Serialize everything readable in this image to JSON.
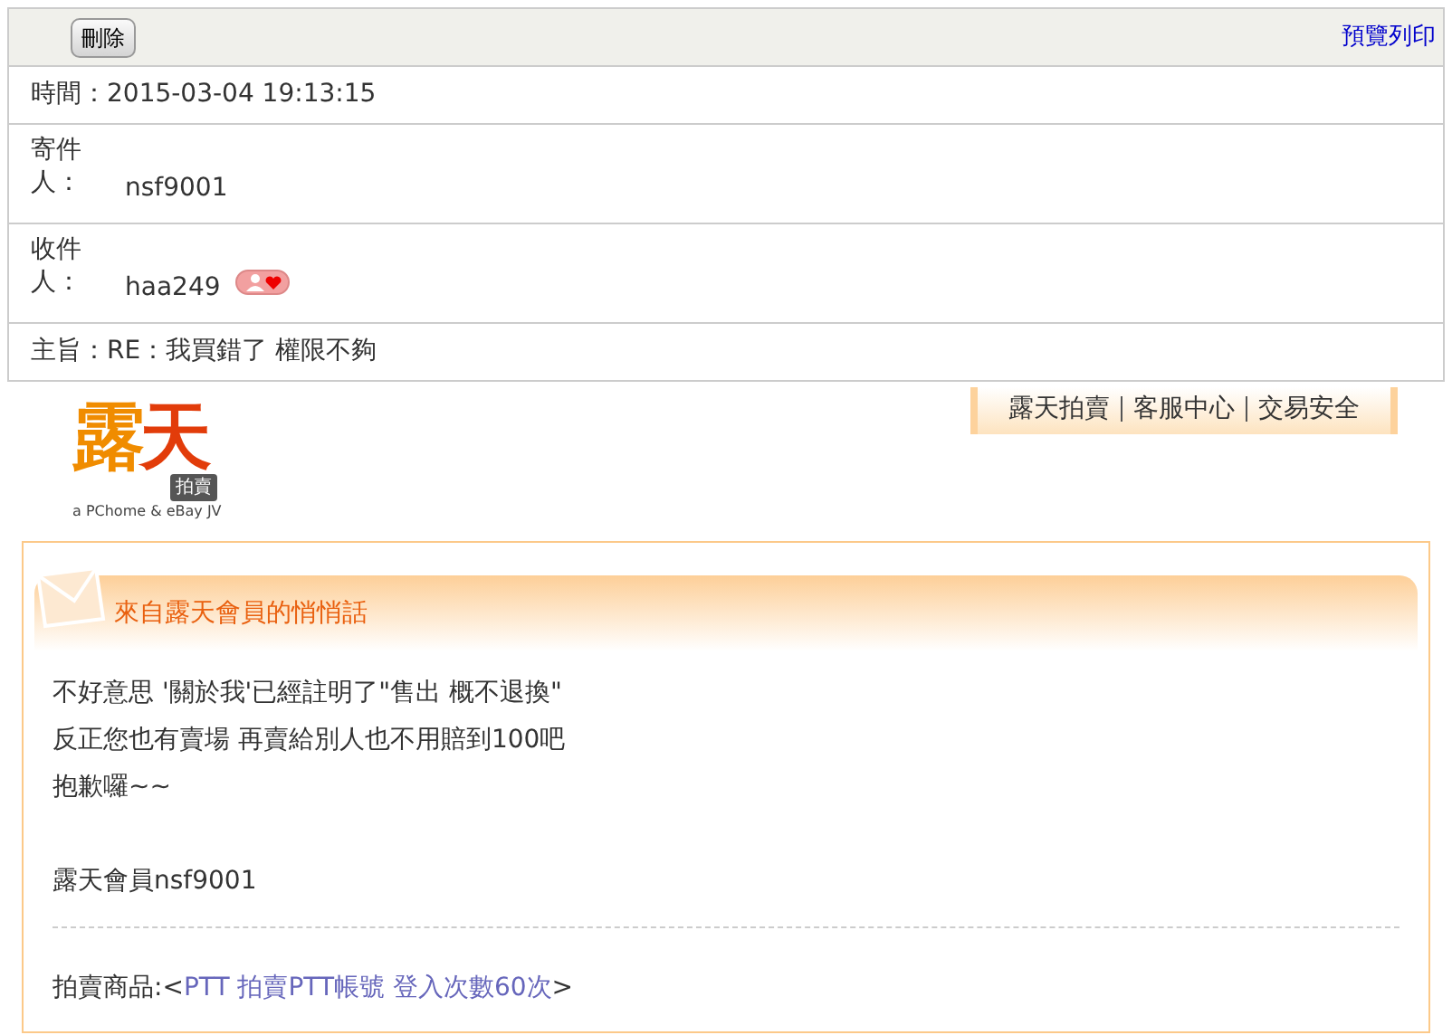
{
  "toolbar": {
    "delete_button": "刪除",
    "print_link": "預覽列印"
  },
  "fields": [
    {
      "kind": "inline",
      "label": "時間：",
      "value": "2015-03-04 19:13:15"
    },
    {
      "kind": "stacked",
      "label": "寄件人：",
      "value": "nsf9001"
    },
    {
      "kind": "stacked",
      "label": "收件人：",
      "value": "haa249",
      "badge": true
    },
    {
      "kind": "inline",
      "label": "主旨：",
      "value": "RE：我買錯了 權限不夠"
    }
  ],
  "logo": {
    "title": "露天",
    "tag": "拍賣",
    "tagline": "a PChome & eBay JV"
  },
  "top_links": [
    "露天拍賣",
    "客服中心",
    "交易安全"
  ],
  "message": {
    "title": "來自露天會員的悄悄話",
    "lines": [
      "不好意思 '關於我'已經註明了\"售出 概不退換\"",
      "反正您也有賣場 再賣給別人也不用賠到100吧",
      "抱歉囉~~"
    ],
    "signature": "露天會員nsf9001",
    "product_prefix": "拍賣商品:<",
    "product_link": "PTT 拍賣PTT帳號 登入次數60次",
    "product_suffix": ">"
  }
}
